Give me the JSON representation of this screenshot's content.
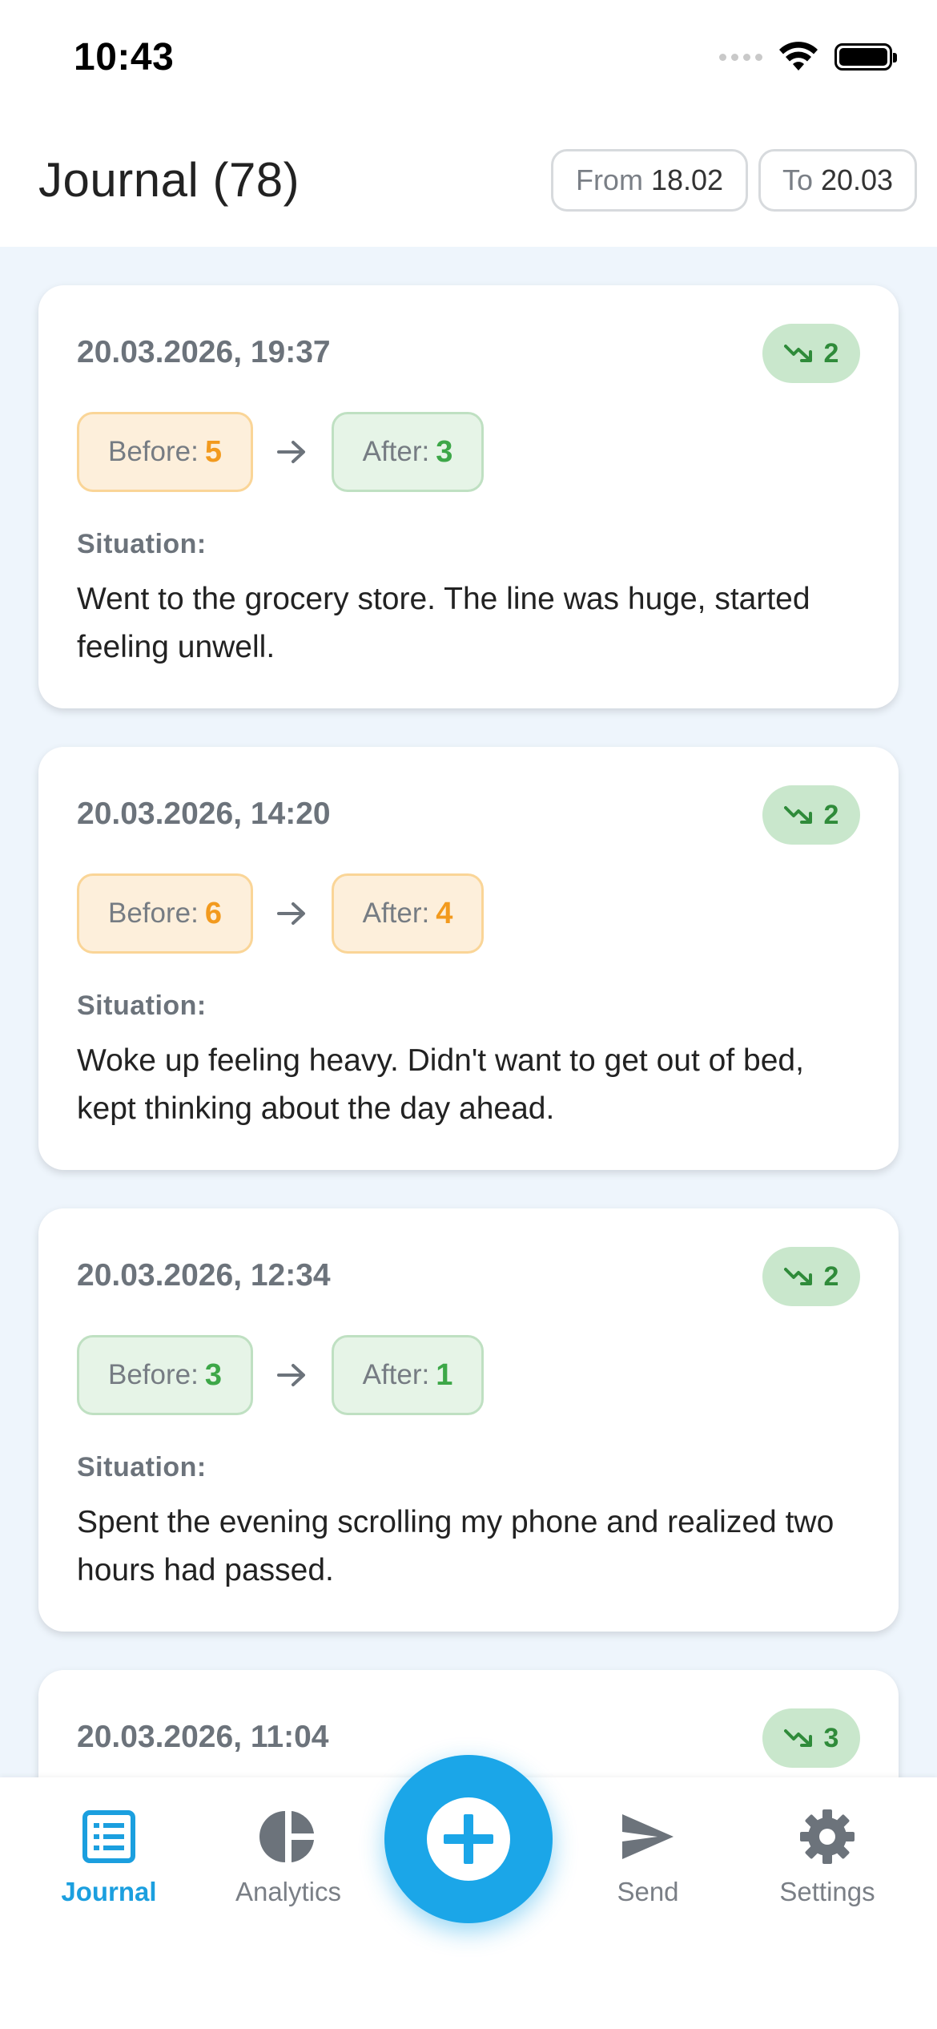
{
  "status_bar": {
    "time": "10:43"
  },
  "header": {
    "title": "Journal (78)",
    "from_label": "From",
    "from_value": "18.02",
    "to_label": "To",
    "to_value": "20.03"
  },
  "labels": {
    "before": "Before:",
    "after": "After:",
    "situation": "Situation:"
  },
  "entries": [
    {
      "datetime": "20.03.2026, 19:37",
      "delta": "2",
      "before": "5",
      "after": "3",
      "situation": "Went to the grocery store. The line was huge, started feeling unwell."
    },
    {
      "datetime": "20.03.2026, 14:20",
      "delta": "2",
      "before": "6",
      "after": "4",
      "situation": "Woke up feeling heavy. Didn't want to get out of bed, kept thinking about the day ahead."
    },
    {
      "datetime": "20.03.2026, 12:34",
      "delta": "2",
      "before": "3",
      "after": "1",
      "situation": "Spent the evening scrolling my phone and realized two hours had passed."
    },
    {
      "datetime": "20.03.2026, 11:04",
      "delta": "3"
    }
  ],
  "nav": {
    "journal": "Journal",
    "analytics": "Analytics",
    "send": "Send",
    "settings": "Settings"
  },
  "colors": {
    "accent": "#1ba6e8",
    "green": "#3da748",
    "orange": "#f29a1e",
    "background": "#eef5fc"
  },
  "icons": {
    "trend": "trending-down-icon",
    "arrow": "arrow-right-icon",
    "journal": "list-icon",
    "analytics": "pie-chart-icon",
    "send": "send-icon",
    "settings": "gear-icon",
    "fab": "plus-circle-icon"
  }
}
